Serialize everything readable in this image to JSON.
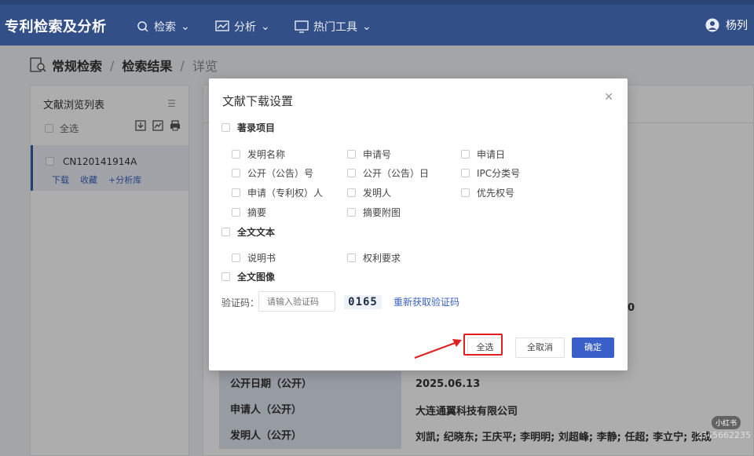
{
  "nav": {
    "brand": "专利检索及分析",
    "items": [
      {
        "label": "检索",
        "icon": "search-icon"
      },
      {
        "label": "分析",
        "icon": "analysis-icon"
      },
      {
        "label": "热门工具",
        "icon": "monitor-icon"
      }
    ],
    "user": "杨列"
  },
  "breadcrumb": {
    "items": [
      "常规检索",
      "检索结果",
      "详览"
    ]
  },
  "sidebar": {
    "title": "文献浏览列表",
    "select_all": "全选",
    "item": {
      "number": "CN120141914A",
      "download": "下载",
      "favorite": "收藏",
      "add_analysis": "+分析库"
    }
  },
  "detail": {
    "stray_value": "0",
    "rows": [
      {
        "key": "公开日期（公开）",
        "value": "2025.06.13"
      },
      {
        "key": "申请人（公开）",
        "value": "大连通翼科技有限公司"
      },
      {
        "key": "发明人（公开）",
        "value": "刘凯; 纪晓东; 王庆平; 李明明; 刘超峰; 李静; 任超; 李立宁; 张成"
      }
    ]
  },
  "modal": {
    "title": "文献下载设置",
    "groups": {
      "bibliographic": "著录项目",
      "fulltext_text": "全文文本",
      "fulltext_image": "全文图像"
    },
    "biblio_options": [
      "发明名称",
      "申请号",
      "申请日",
      "公开（公告）号",
      "公开（公告）日",
      "IPC分类号",
      "申请（专利权）人",
      "发明人",
      "优先权号",
      "摘要",
      "摘要附图"
    ],
    "fulltext_options": [
      "说明书",
      "权利要求"
    ],
    "captcha_label": "验证码：",
    "captcha_placeholder": "请输入验证码",
    "captcha_code": "0165",
    "captcha_refresh": "重新获取验证码",
    "btn_select_all": "全选",
    "btn_deselect_all": "全取消",
    "btn_confirm": "确定"
  },
  "watermark": {
    "badge": "小红书",
    "text": "2345662235"
  }
}
